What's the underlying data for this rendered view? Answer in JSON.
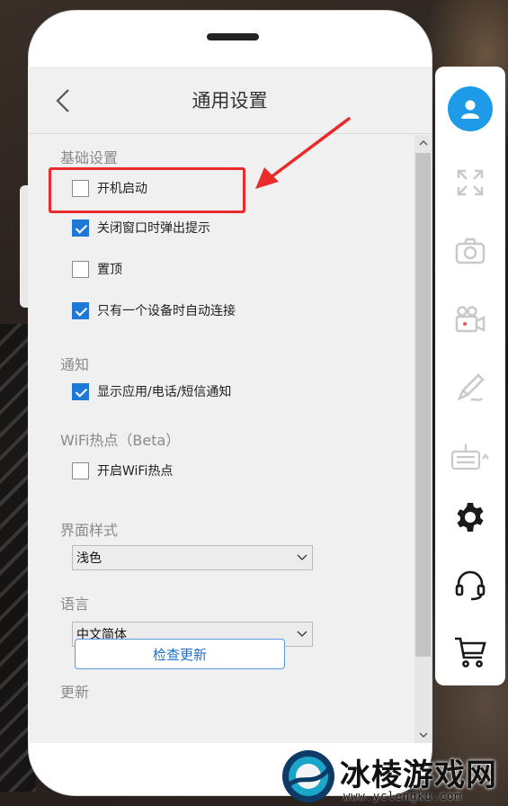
{
  "window": {
    "title": "通用设置"
  },
  "sections": {
    "basic": {
      "title": "基础设置",
      "options": [
        {
          "label": "开机启动",
          "checked": false
        },
        {
          "label": "关闭窗口时弹出提示",
          "checked": true
        },
        {
          "label": "置顶",
          "checked": false
        },
        {
          "label": "只有一个设备时自动连接",
          "checked": true
        }
      ]
    },
    "notify": {
      "title": "通知",
      "options": [
        {
          "label": "显示应用/电话/短信通知",
          "checked": true
        }
      ]
    },
    "wifi": {
      "title": "WiFi热点（Beta）",
      "options": [
        {
          "label": "开启WiFi热点",
          "checked": false
        }
      ]
    },
    "theme": {
      "title": "界面样式",
      "selected": "浅色"
    },
    "language": {
      "title": "语言",
      "selected": "中文简体"
    },
    "update": {
      "title": "更新",
      "button_label": "检查更新"
    }
  },
  "toolbar": {
    "items": [
      "user-icon",
      "fullscreen-icon",
      "camera-icon",
      "record-video-icon",
      "brush-icon",
      "keyboard-icon",
      "gear-icon",
      "headset-icon",
      "cart-icon"
    ]
  },
  "colors": {
    "accent": "#1e78d6",
    "annotation": "#ea2b2b",
    "avatar": "#1e9be8"
  },
  "watermark": {
    "name": "冰棱游戏网",
    "url": "www.yclengku.com"
  }
}
